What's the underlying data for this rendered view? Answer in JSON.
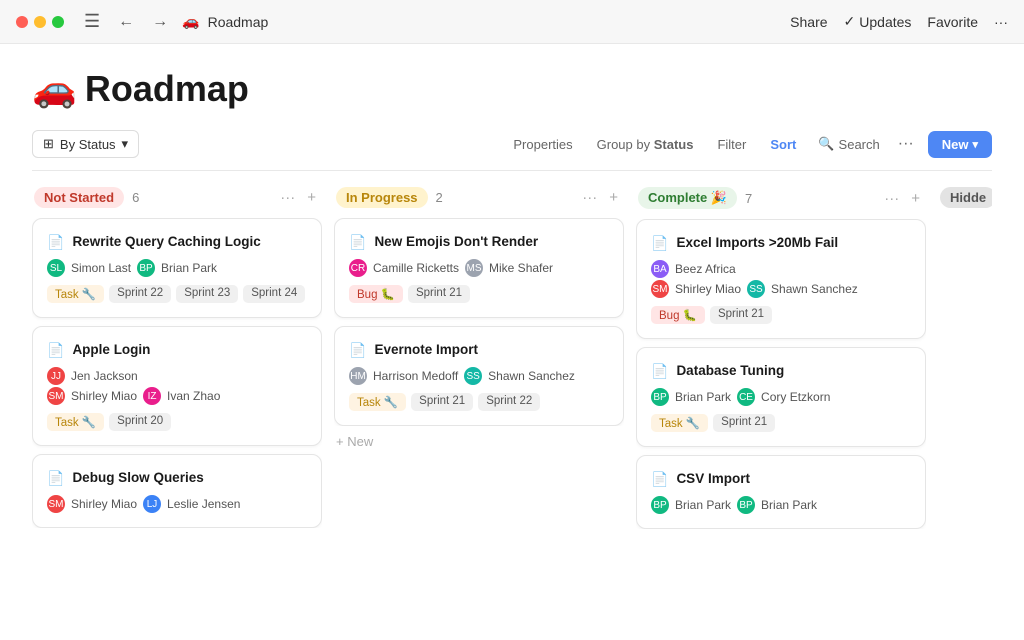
{
  "titlebar": {
    "page_title": "Roadmap",
    "page_emoji": "🚗",
    "share_label": "Share",
    "updates_label": "Updates",
    "favorite_label": "Favorite",
    "more_label": "···"
  },
  "heading": {
    "emoji": "🚗",
    "title": "Roadmap"
  },
  "toolbar": {
    "by_status_label": "By Status",
    "properties_label": "Properties",
    "group_by_label": "Group by",
    "group_by_value": "Status",
    "filter_label": "Filter",
    "sort_label": "Sort",
    "search_label": "Search",
    "more_label": "···",
    "new_label": "New"
  },
  "columns": [
    {
      "id": "not-started",
      "status_label": "Not Started",
      "count": "6",
      "badge_class": "badge-not-started",
      "cards": [
        {
          "title": "Rewrite Query Caching Logic",
          "assignees": [
            "Simon Last",
            "Brian Park"
          ],
          "tags": [
            {
              "label": "Task 🔧",
              "type": "task"
            }
          ],
          "sprints": [
            "Sprint 22",
            "Sprint 23",
            "Sprint 24"
          ]
        },
        {
          "title": "Apple Login",
          "assignees": [
            "Jen Jackson",
            "Shirley Miao",
            "Ivan Zhao"
          ],
          "tags": [
            {
              "label": "Task 🔧",
              "type": "task"
            }
          ],
          "sprints": [
            "Sprint 20"
          ]
        },
        {
          "title": "Debug Slow Queries",
          "assignees": [
            "Shirley Miao",
            "Leslie Jensen"
          ],
          "tags": [],
          "sprints": []
        }
      ]
    },
    {
      "id": "in-progress",
      "status_label": "In Progress",
      "count": "2",
      "badge_class": "badge-in-progress",
      "cards": [
        {
          "title": "New Emojis Don't Render",
          "assignees": [
            "Camille Ricketts",
            "Mike Shafer"
          ],
          "tags": [
            {
              "label": "Bug 🐛",
              "type": "bug"
            }
          ],
          "sprints": [
            "Sprint 21"
          ]
        },
        {
          "title": "Evernote Import",
          "assignees": [
            "Harrison Medoff",
            "Shawn Sanchez"
          ],
          "tags": [
            {
              "label": "Task 🔧",
              "type": "task"
            }
          ],
          "sprints": [
            "Sprint 21",
            "Sprint 22"
          ]
        }
      ],
      "new_item_label": "+ New"
    },
    {
      "id": "complete",
      "status_label": "Complete 🎉",
      "count": "7",
      "badge_class": "badge-complete",
      "cards": [
        {
          "title": "Excel Imports >20Mb Fail",
          "assignees": [
            "Beez Africa",
            "Shirley Miao",
            "Shawn Sanchez"
          ],
          "tags": [
            {
              "label": "Bug 🐛",
              "type": "bug"
            }
          ],
          "sprints": [
            "Sprint 21"
          ]
        },
        {
          "title": "Database Tuning",
          "assignees": [
            "Brian Park",
            "Cory Etzkorn"
          ],
          "tags": [
            {
              "label": "Task 🔧",
              "type": "task"
            }
          ],
          "sprints": [
            "Sprint 21"
          ]
        },
        {
          "title": "CSV Import",
          "assignees": [
            "Brian Park",
            "Brian Park"
          ],
          "tags": [],
          "sprints": []
        }
      ]
    },
    {
      "id": "hidden",
      "status_label": "Hidde",
      "count": "",
      "badge_class": "badge-hidden",
      "cards": []
    }
  ]
}
